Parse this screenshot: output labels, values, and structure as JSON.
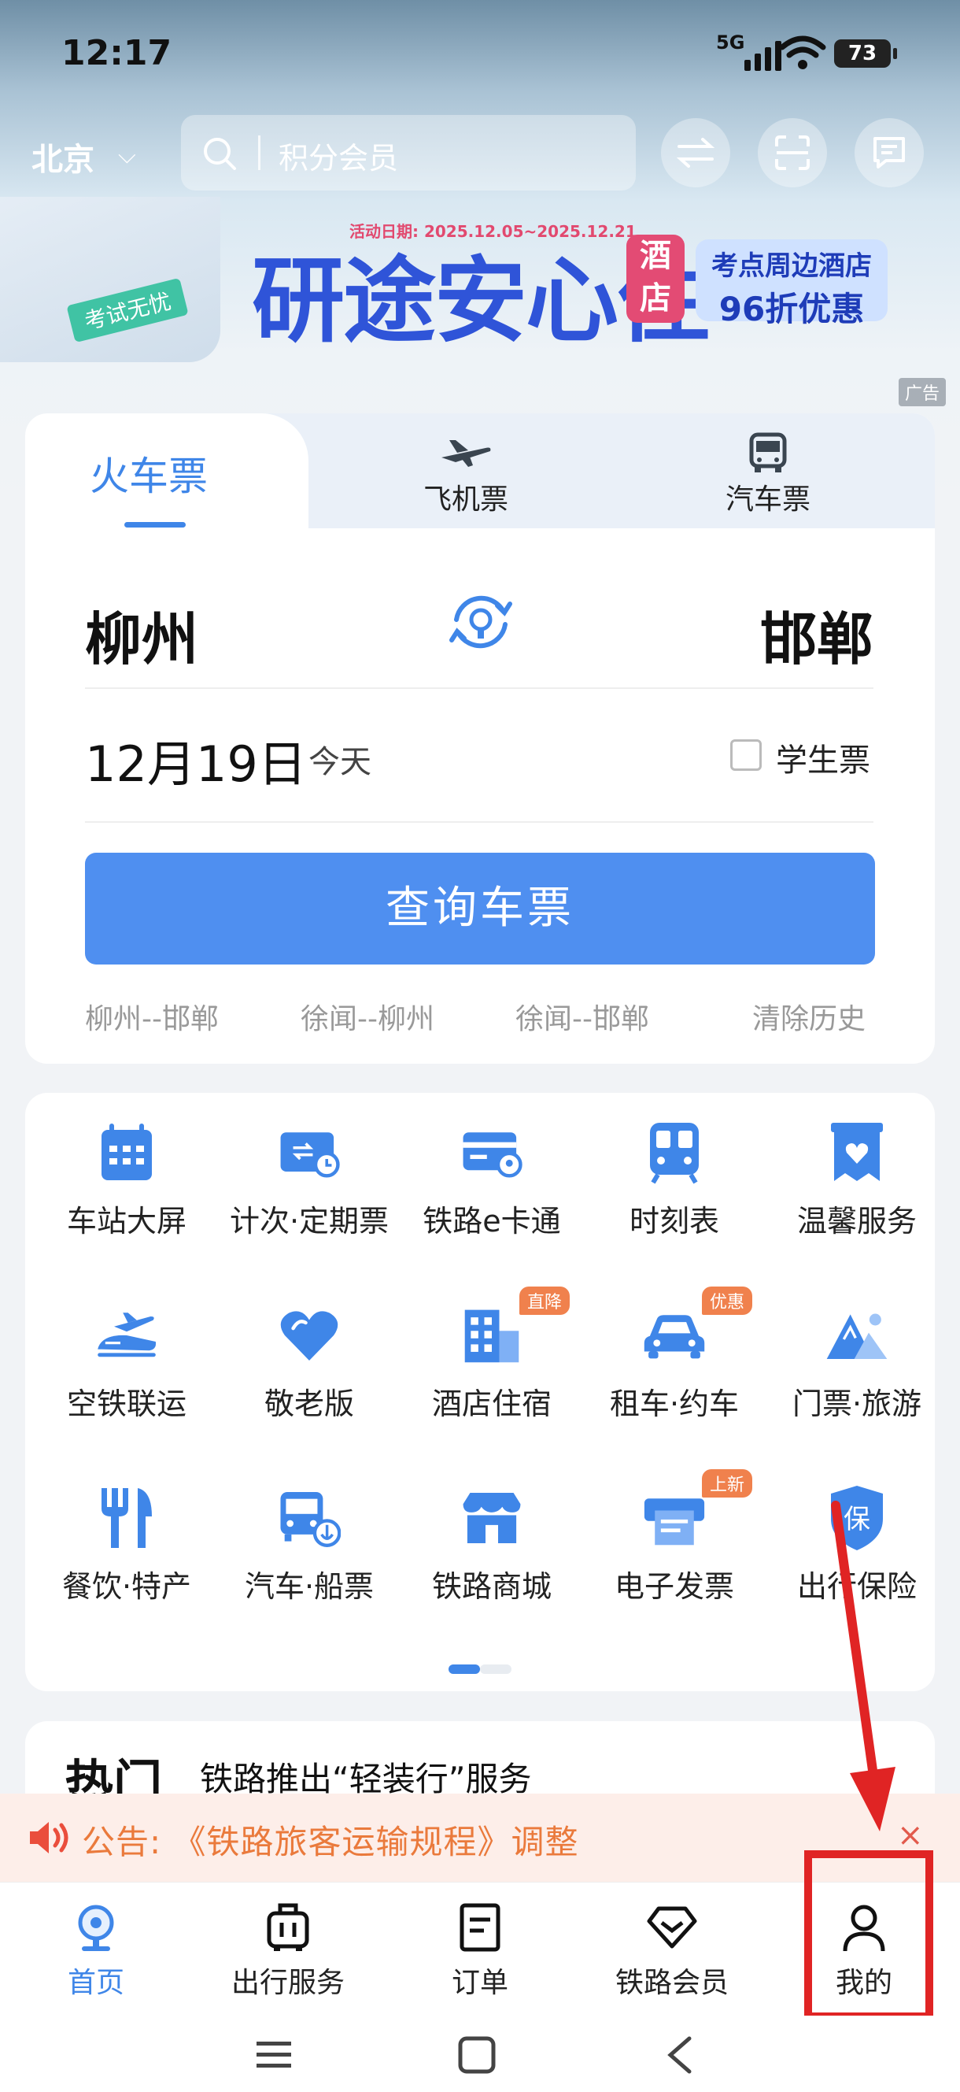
{
  "status": {
    "time": "12:17",
    "network": "5G",
    "battery": "73"
  },
  "header": {
    "city": "北京",
    "search_placeholder": "积分会员"
  },
  "banner": {
    "date": "活动日期: 2025.12.05~2025.12.21",
    "title": "研途安心住",
    "hotel_tag": "酒店",
    "promo_line1": "考点周边酒店",
    "promo_line2": "96折优惠",
    "exam_tag": "考试无忧",
    "ad_label": "广告"
  },
  "tabs": {
    "train": "火车票",
    "flight": "飞机票",
    "bus": "汽车票"
  },
  "trip": {
    "from": "柳州",
    "to": "邯郸",
    "date": "12月19日",
    "date_hint": "今天",
    "student_label": "学生票",
    "query_button": "查询车票"
  },
  "history": [
    "柳州--邯郸",
    "徐闻--柳州",
    "徐闻--邯郸"
  ],
  "clear_history": "清除历史",
  "services": [
    {
      "label": "车站大屏",
      "icon": "station-screen-icon"
    },
    {
      "label": "计次·定期票",
      "icon": "ticket-card-icon"
    },
    {
      "label": "铁路e卡通",
      "icon": "e-card-icon"
    },
    {
      "label": "时刻表",
      "icon": "timetable-icon"
    },
    {
      "label": "温馨服务",
      "icon": "care-service-icon"
    },
    {
      "label": "空铁联运",
      "icon": "air-rail-icon"
    },
    {
      "label": "敬老版",
      "icon": "heart-icon"
    },
    {
      "label": "酒店住宿",
      "icon": "hotel-icon",
      "badge": "直降"
    },
    {
      "label": "租车·约车",
      "icon": "car-icon",
      "badge": "优惠"
    },
    {
      "label": "门票·旅游",
      "icon": "mountain-icon"
    },
    {
      "label": "餐饮·特产",
      "icon": "dining-icon"
    },
    {
      "label": "汽车·船票",
      "icon": "bus-ship-icon"
    },
    {
      "label": "铁路商城",
      "icon": "shop-icon"
    },
    {
      "label": "电子发票",
      "icon": "invoice-icon",
      "badge": "上新"
    },
    {
      "label": "出行保险",
      "icon": "insurance-icon"
    }
  ],
  "hot": {
    "title": "热门",
    "headline": "铁路推出“轻装行”服务"
  },
  "notice": {
    "text": "公告: 《铁路旅客运输规程》调整",
    "close": "×"
  },
  "nav": [
    {
      "label": "首页",
      "icon": "home-icon",
      "active": true
    },
    {
      "label": "出行服务",
      "icon": "luggage-icon"
    },
    {
      "label": "订单",
      "icon": "order-icon"
    },
    {
      "label": "铁路会员",
      "icon": "member-icon"
    },
    {
      "label": "我的",
      "icon": "user-icon"
    }
  ],
  "colors": {
    "accent": "#3f86e8",
    "button": "#4f8ff0",
    "notice": "#ea7a3c",
    "highlight": "#e02424"
  }
}
